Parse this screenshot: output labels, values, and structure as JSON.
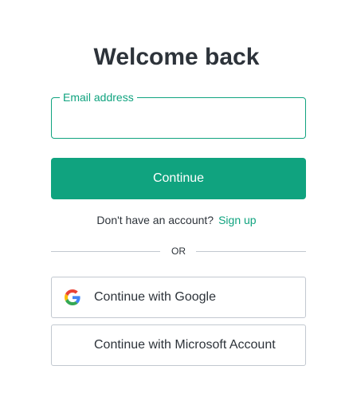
{
  "login": {
    "title": "Welcome back",
    "email_label": "Email address",
    "email_value": "",
    "continue_label": "Continue",
    "no_account_text": "Don't have an account?",
    "signup_link": "Sign up",
    "divider_text": "OR",
    "google_label": "Continue with Google",
    "microsoft_label": "Continue with Microsoft Account"
  },
  "icons": {
    "google": "google-logo-icon",
    "microsoft": "microsoft-logo-icon"
  },
  "colors": {
    "accent": "#10a37f",
    "text": "#2d333a",
    "border": "#c2c8d0",
    "google_blue": "#4285F4",
    "google_green": "#34A853",
    "google_yellow": "#FBBC05",
    "google_red": "#EA4335",
    "ms_red": "#F25022",
    "ms_green": "#7FBA00",
    "ms_blue": "#00A4EF",
    "ms_yellow": "#FFB900"
  }
}
